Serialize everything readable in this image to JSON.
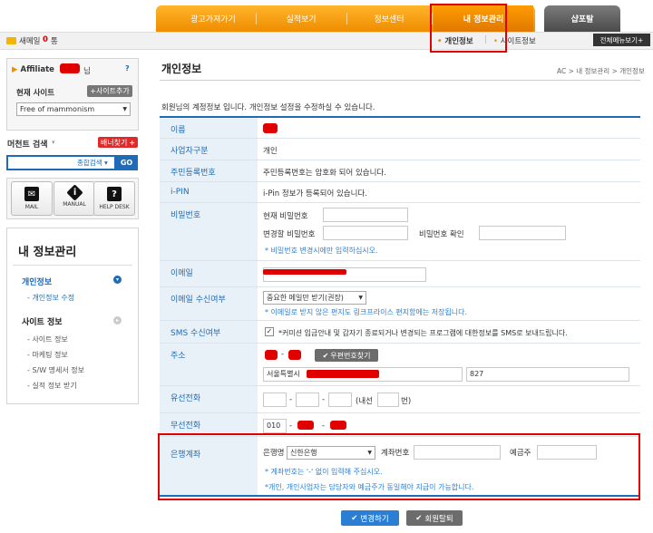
{
  "nav": {
    "tabs": [
      "광고가져가기",
      "실적보기",
      "정보센터",
      "내 정보관리"
    ],
    "sap": "샵포탈"
  },
  "subbar": {
    "new_mail": "새메일",
    "mail_count": "0",
    "mail_unit": "통",
    "subtabs": [
      "개인정보",
      "사이트정보"
    ],
    "all_menu": "전체메뉴보기"
  },
  "sidebar": {
    "affiliate_label": "Affiliate",
    "affiliate_suffix": "님",
    "help": "?",
    "current_site_label": "현재 사이트",
    "add_site": "+사이트추가",
    "site_value": "Free of mammonism",
    "merchant_search_label": "머천트 검색",
    "banner_btn": "배너찾기",
    "search_type": "종합검색",
    "go": "GO",
    "icons": [
      "MAIL",
      "MANUAL",
      "HELP DESK"
    ],
    "section_title": "내 정보관리",
    "menu": {
      "personal": "개인정보",
      "personal_sub": "개인정보 수정",
      "site": "사이트 정보",
      "site_subs": [
        "사이트 정보",
        "마케팅 정보",
        "S/W 명세서 정보",
        "실적 정보 받기"
      ]
    }
  },
  "main": {
    "title": "개인정보",
    "breadcrumb": "AC > 내 정보관리 > 개인정보",
    "desc": "회원님의 계정정보 입니다. 개인정보 설정을 수정하실 수 있습니다.",
    "rows": {
      "name": {
        "label": "이름"
      },
      "biz_type": {
        "label": "사업자구분",
        "value": "개인"
      },
      "ssn": {
        "label": "주민등록번호",
        "value": "주민등록번호는 암호화 되어 있습니다."
      },
      "ipin": {
        "label": "i-PIN",
        "value": "i-Pin 정보가 등록되어 있습니다."
      },
      "password": {
        "label": "비밀번호",
        "current": "현재 비밀번호",
        "new": "변경할 비밀번호",
        "confirm": "비밀번호 확인",
        "note": "* 비밀번호 변경시에만 입력하십시오."
      },
      "email": {
        "label": "이메일"
      },
      "email_recv": {
        "label": "이메일 수신여부",
        "select": "중요한 메일만 받기(권장)",
        "note": "* 이메일로 받지 않은 편지도 링크프라이스 편지함에는 저장됩니다."
      },
      "sms": {
        "label": "SMS 수신여부",
        "value": "*커미션 입금안내 및 갑자기 종료되거나 변경되는 프로그램에 대한정보를 SMS로 보내드립니다."
      },
      "address": {
        "label": "주소",
        "zip_btn": "우편번호찾기",
        "addr1": "서울특별시",
        "addr2": "827"
      },
      "phone": {
        "label": "유선전화",
        "dash": "-",
        "ext_open": "(내선",
        "ext_close": "번)"
      },
      "mobile": {
        "label": "무선전화",
        "prefix": "010",
        "dash": "-"
      },
      "bank": {
        "label": "은행계좌",
        "bank_name_label": "은행명",
        "bank_select": "신한은행",
        "account_label": "계좌번호",
        "holder_label": "예금주",
        "note1": "* 계좌번호는 '-' 없이 입력해 주십시오.",
        "note2": "*개인, 개인사업자는 담당자와 예금주가 동일해야 지급이 가능합니다."
      }
    },
    "buttons": {
      "save": "변경하기",
      "withdraw": "회원탈퇴"
    }
  },
  "colors": {
    "accent_blue": "#1e6bb8",
    "orange": "#f5a000",
    "red": "#e00000",
    "label_bg": "#e8f0f8"
  }
}
